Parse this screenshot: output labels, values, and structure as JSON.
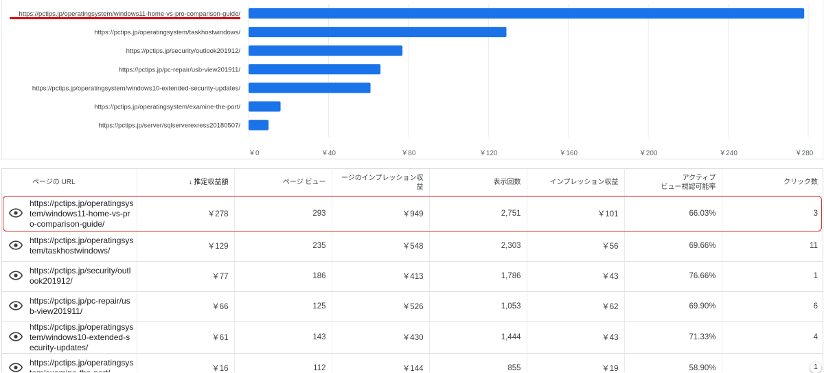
{
  "chart_data": {
    "type": "bar",
    "orientation": "horizontal",
    "categories": [
      "https://pctips.jp/operatingsystem/windows11-home-vs-pro-comparison-guide/",
      "https://pctips.jp/operatingsystem/taskhostwindows/",
      "https://pctips.jp/security/outlook201912/",
      "https://pctips.jp/pc-repair/usb-view201911/",
      "https://pctips.jp/operatingsystem/windows10-extended-security-updates/",
      "https://pctips.jp/operatingsystem/examine-the-port/",
      "https://pctips.jp/server/sqlserverexress20180507/"
    ],
    "values": [
      278,
      129,
      77,
      66,
      61,
      16,
      10
    ],
    "xlim": [
      0,
      280
    ],
    "x_ticks": [
      0,
      40,
      80,
      120,
      160,
      200,
      240,
      280
    ],
    "x_tick_labels": [
      "￥0",
      "￥40",
      "￥80",
      "￥120",
      "￥160",
      "￥200",
      "￥240",
      "￥280"
    ],
    "grid": true,
    "bar_color": "#1a73e8",
    "highlight_color": "#e00000"
  },
  "table": {
    "headers": [
      "ページの URL",
      "↓ 推定収益額",
      "ページ ビュー",
      "ージのインプレッション収益",
      "表示回数",
      "インプレッション収益",
      "アクティブ\nビュー視認可能率",
      "クリック数"
    ],
    "rows": [
      {
        "url": "https://pctips.jp/operatingsystem/windows11-home-vs-pro-comparison-guide/",
        "revenue": "￥278",
        "pageviews": "293",
        "page_rpm": "￥949",
        "impressions": "2,751",
        "impression_rpm": "￥101",
        "viewability": "66.03%",
        "clicks": "3"
      },
      {
        "url": "https://pctips.jp/operatingsystem/taskhostwindows/",
        "revenue": "￥129",
        "pageviews": "235",
        "page_rpm": "￥548",
        "impressions": "2,303",
        "impression_rpm": "￥56",
        "viewability": "69.66%",
        "clicks": "11"
      },
      {
        "url": "https://pctips.jp/security/outlook201912/",
        "revenue": "￥77",
        "pageviews": "186",
        "page_rpm": "￥413",
        "impressions": "1,786",
        "impression_rpm": "￥43",
        "viewability": "76.66%",
        "clicks": "1"
      },
      {
        "url": "https://pctips.jp/pc-repair/usb-view201911/",
        "revenue": "￥66",
        "pageviews": "125",
        "page_rpm": "￥526",
        "impressions": "1,053",
        "impression_rpm": "￥62",
        "viewability": "69.90%",
        "clicks": "6"
      },
      {
        "url": "https://pctips.jp/operatingsystem/windows10-extended-security-updates/",
        "revenue": "￥61",
        "pageviews": "143",
        "page_rpm": "￥430",
        "impressions": "1,444",
        "impression_rpm": "￥43",
        "viewability": "71.33%",
        "clicks": "4"
      },
      {
        "url": "https://pctips.jp/operatingsystem/examine-the-port/",
        "revenue": "￥16",
        "pageviews": "112",
        "page_rpm": "￥144",
        "impressions": "855",
        "impression_rpm": "￥19",
        "viewability": "58.90%",
        "clicks": "1"
      }
    ],
    "row_icon": "eye-icon"
  },
  "colors": {
    "accent": "#1a73e8",
    "highlight": "#d93025"
  }
}
